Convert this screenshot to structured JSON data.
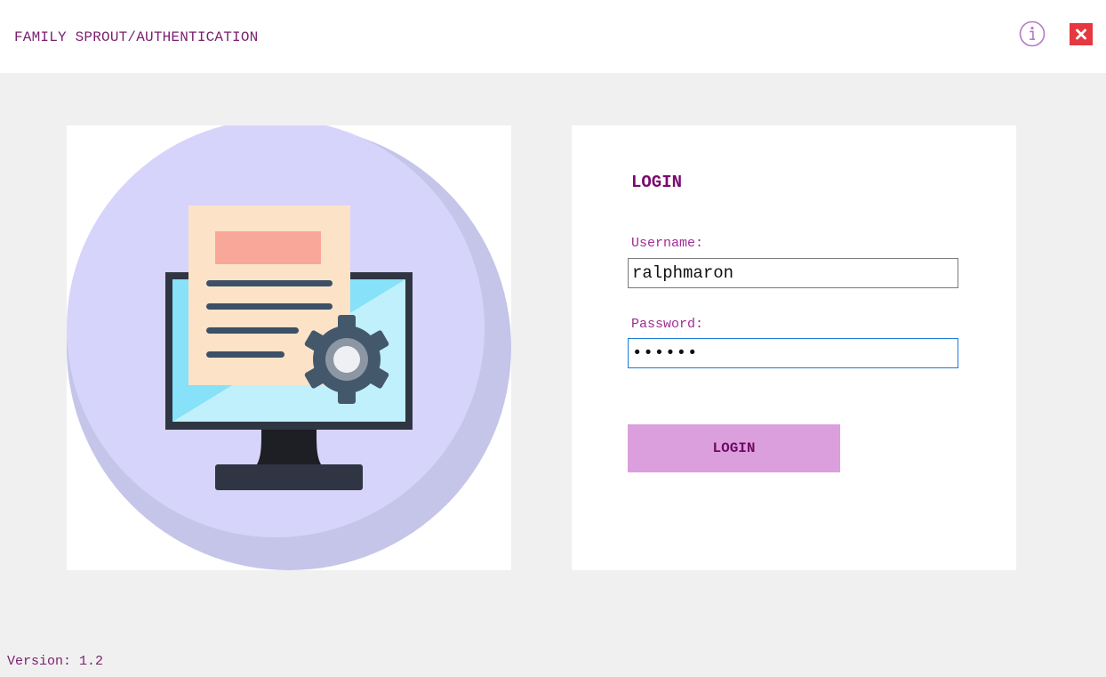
{
  "window": {
    "title": "FAMILY SPROUT/AUTHENTICATION",
    "info_icon": "info-circle-icon",
    "close_icon": "close-x-icon"
  },
  "illustration": {
    "icon": "computer-document-settings-icon"
  },
  "login": {
    "heading": "LOGIN",
    "username_label": "Username:",
    "username_value": "ralphmaron",
    "password_label": "Password:",
    "password_value": "••••••",
    "button_label": "LOGIN"
  },
  "footer": {
    "version": "Version: 1.2"
  },
  "colors": {
    "accent_text": "#7a1f6e",
    "label_text": "#a02c97",
    "button_bg": "#dc9fdd",
    "close_bg": "#e5383f",
    "focus_border": "#1e7bd8"
  }
}
